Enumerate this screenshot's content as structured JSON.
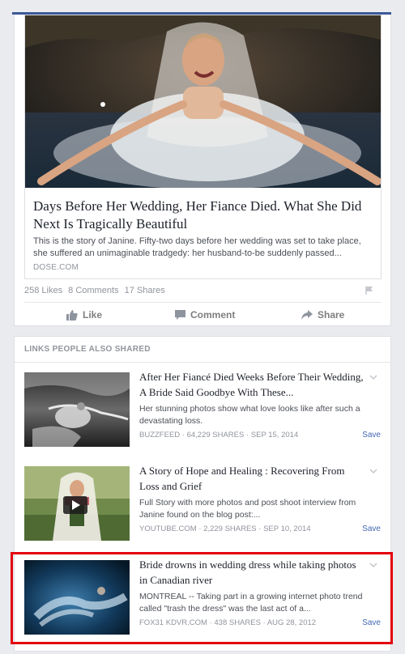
{
  "post": {
    "title": "Days Before Her Wedding, Her Fiance Died. What She Did Next Is Tragically Beautiful",
    "description": "This is the story of Janine. Fifty-two days before her wedding was set to take place, she suffered an unimaginable tradgedy: her husband-to-be suddenly passed...",
    "domain": "DOSE.COM",
    "likes": "258 Likes",
    "comments": "8 Comments",
    "shares": "17 Shares",
    "like_label": "Like",
    "comment_label": "Comment",
    "share_label": "Share"
  },
  "related": {
    "section_title": "LINKS PEOPLE ALSO SHARED",
    "items": [
      {
        "title": "After Her Fiancé Died Weeks Before Their Wedding, A Bride Said Goodbye With These...",
        "description": "Her stunning photos show what love looks like after such a devastating loss.",
        "meta": "BUZZFEED · 64,229 SHARES · SEP 15, 2014",
        "save": "Save"
      },
      {
        "title": "A Story of Hope and Healing : Recovering From Loss and Grief",
        "description": "Full Story with more photos and post shoot interview from Janine found on the blog post:...",
        "meta": "YOUTUBE.COM · 2,229 SHARES · SEP 10, 2014",
        "save": "Save"
      },
      {
        "title": "Bride drowns in wedding dress while taking photos in Canadian river",
        "description": "MONTREAL -- Taking part in a growing internet photo trend called \"trash the dress\" was the last act of a...",
        "meta": "FOX31 KDVR.COM · 438 SHARES · AUG 28, 2012",
        "save": "Save"
      }
    ]
  },
  "colors": {
    "brand_blue": "#3b5998",
    "link_blue": "#4267b2",
    "highlight_red": "#e3000f"
  }
}
